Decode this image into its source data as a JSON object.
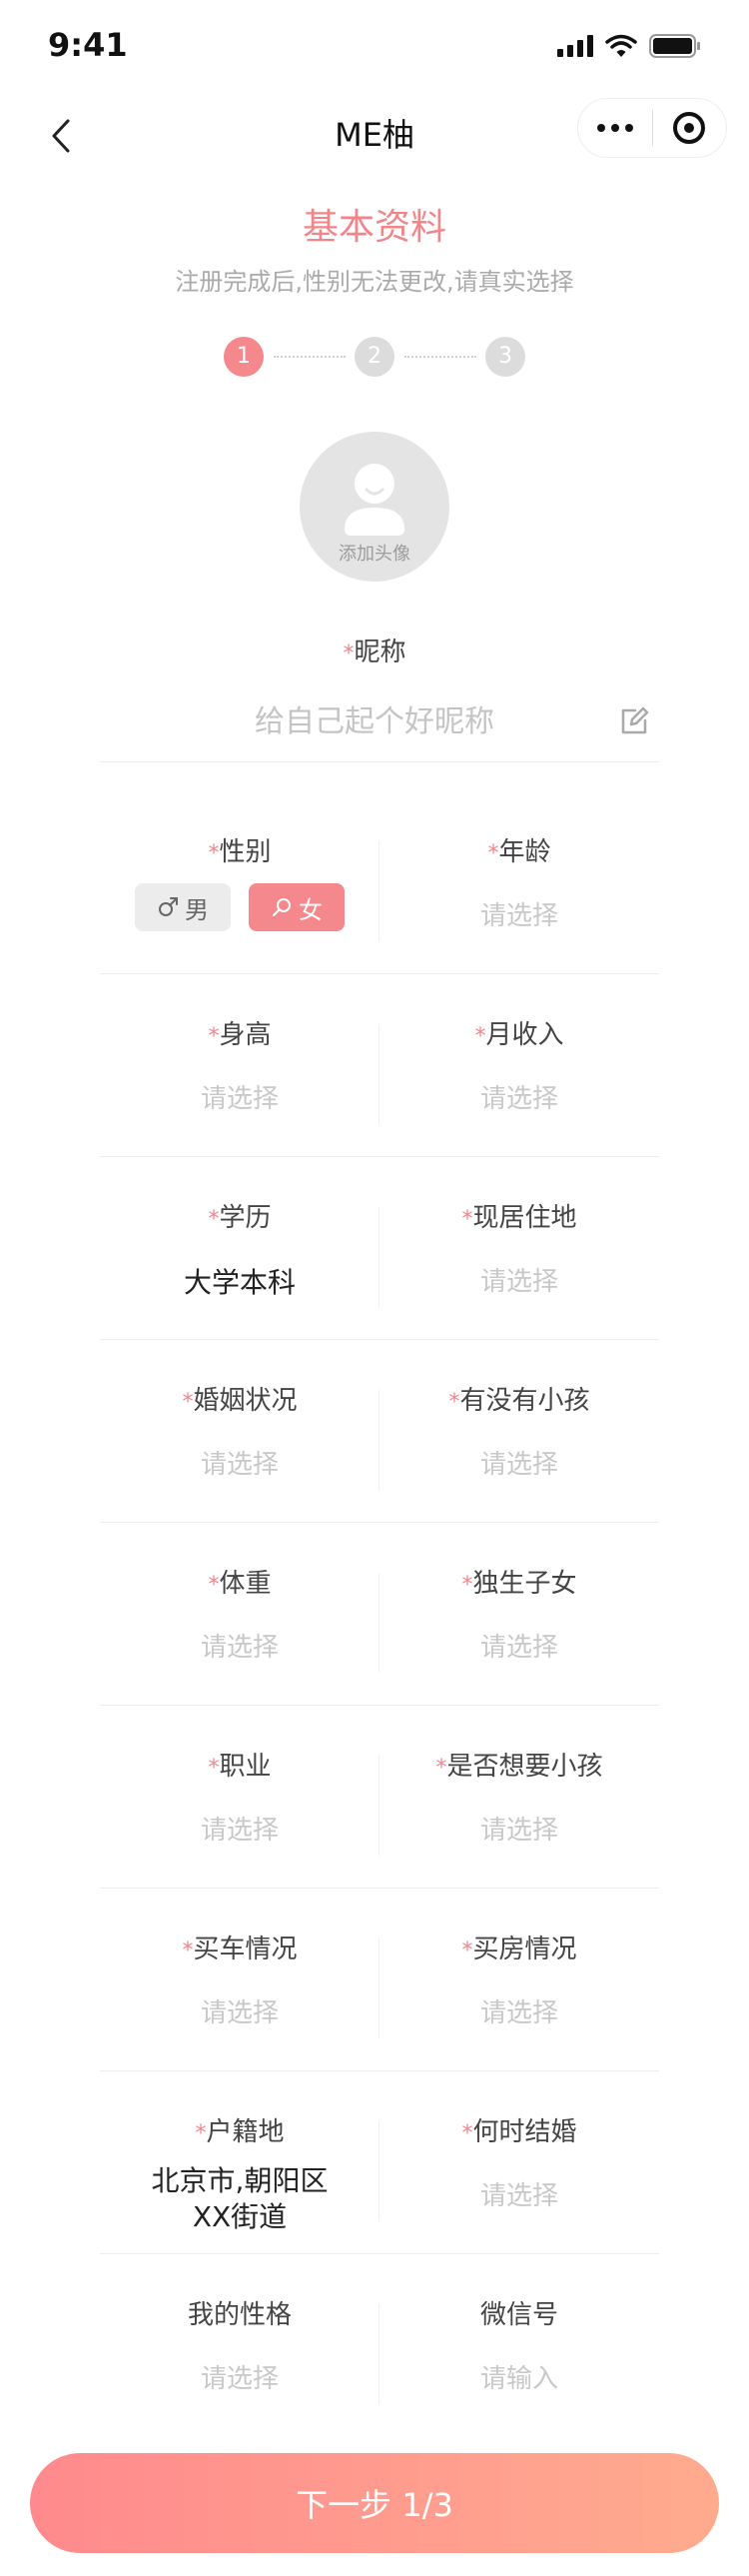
{
  "status_bar": {
    "time": "9:41"
  },
  "nav": {
    "title": "ME柚"
  },
  "header": {
    "title": "基本资料",
    "subtitle": "注册完成后,性别无法更改,请真实选择"
  },
  "steps": [
    {
      "label": "1",
      "active": true
    },
    {
      "label": "2",
      "active": false
    },
    {
      "label": "3",
      "active": false
    }
  ],
  "avatar": {
    "label": "添加头像"
  },
  "required_mark": "*",
  "nickname": {
    "label": "昵称",
    "placeholder": "给自己起个好昵称"
  },
  "gender": {
    "label": "性别",
    "male": "男",
    "female": "女",
    "selected": "女"
  },
  "fields": {
    "age": {
      "label": "年龄",
      "value": "请选择"
    },
    "height": {
      "label": "身高",
      "value": "请选择"
    },
    "income": {
      "label": "月收入",
      "value": "请选择"
    },
    "education": {
      "label": "学历",
      "value": "大学本科"
    },
    "residence": {
      "label": "现居住地",
      "value": "请选择"
    },
    "marital": {
      "label": "婚姻状况",
      "value": "请选择"
    },
    "children": {
      "label": "有没有小孩",
      "value": "请选择"
    },
    "weight": {
      "label": "体重",
      "value": "请选择"
    },
    "only_child": {
      "label": "独生子女",
      "value": "请选择"
    },
    "occupation": {
      "label": "职业",
      "value": "请选择"
    },
    "want_children": {
      "label": "是否想要小孩",
      "value": "请选择"
    },
    "car": {
      "label": "买车情况",
      "value": "请选择"
    },
    "house": {
      "label": "买房情况",
      "value": "请选择"
    },
    "hukou": {
      "label": "户籍地",
      "value_line1": "北京市,朝阳区",
      "value_line2": "XX街道"
    },
    "marry_when": {
      "label": "何时结婚",
      "value": "请选择"
    },
    "personality": {
      "label": "我的性格",
      "value": "请选择"
    },
    "wechat": {
      "label": "微信号",
      "value": "请输入"
    }
  },
  "next_button": {
    "label": "下一步 1/3"
  },
  "colors": {
    "accent": "#f5888c",
    "button_from": "#ff8a8d",
    "button_to": "#ffab8e",
    "placeholder": "#c8c8c8"
  }
}
